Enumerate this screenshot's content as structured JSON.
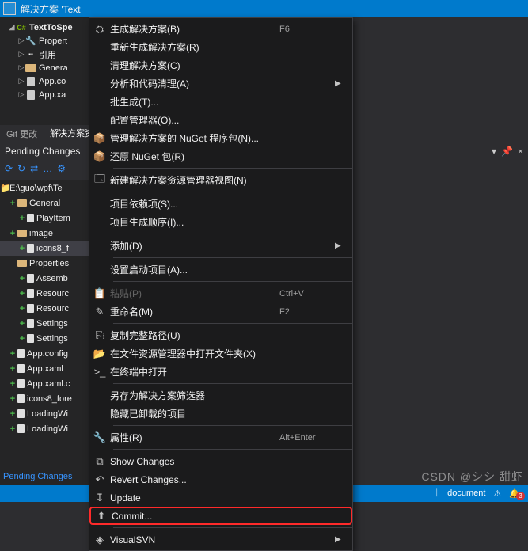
{
  "title_bar_text": "解决方案 'Text",
  "solution_tree": [
    {
      "indent": 10,
      "tri": "◢",
      "icon": "csproj",
      "label": "TextToSpe",
      "bold": true
    },
    {
      "indent": 22,
      "tri": "▷",
      "icon": "wrench",
      "label": "Propert"
    },
    {
      "indent": 22,
      "tri": "▷",
      "icon": "quote",
      "label": "引用"
    },
    {
      "indent": 22,
      "tri": "▷",
      "icon": "folder",
      "label": "Genera"
    },
    {
      "indent": 22,
      "tri": "▷",
      "icon": "file",
      "label": "App.co"
    },
    {
      "indent": 22,
      "tri": "▷",
      "icon": "file",
      "label": "App.xa"
    }
  ],
  "tabs": [
    {
      "label": "Git 更改",
      "active": false
    },
    {
      "label": "解决方案资",
      "active": true
    }
  ],
  "pending_header": "Pending Changes",
  "pin_icon": "📌",
  "close_icon": "×",
  "toolbar": [
    "⟳",
    "↻",
    "⇄",
    "…",
    "⚙"
  ],
  "pending_root": "E:\\guo\\wpf\\Te",
  "pending_items": [
    {
      "plus": true,
      "type": "folder",
      "label": "General",
      "indent": 10
    },
    {
      "plus": true,
      "type": "file",
      "label": "PlayItem",
      "indent": 22
    },
    {
      "plus": true,
      "type": "folder",
      "label": "image",
      "indent": 10
    },
    {
      "plus": true,
      "type": "file",
      "label": "icons8_f",
      "indent": 22,
      "hl": true
    },
    {
      "plus": false,
      "type": "folder",
      "label": "Properties",
      "indent": 10
    },
    {
      "plus": true,
      "type": "file",
      "label": "Assemb",
      "indent": 22
    },
    {
      "plus": true,
      "type": "file",
      "label": "Resourc",
      "indent": 22
    },
    {
      "plus": true,
      "type": "file",
      "label": "Resourc",
      "indent": 22
    },
    {
      "plus": true,
      "type": "file",
      "label": "Settings",
      "indent": 22
    },
    {
      "plus": true,
      "type": "file",
      "label": "Settings",
      "indent": 22
    },
    {
      "plus": true,
      "type": "file",
      "label": "App.config",
      "indent": 10
    },
    {
      "plus": true,
      "type": "file",
      "label": "App.xaml",
      "indent": 10
    },
    {
      "plus": true,
      "type": "file",
      "label": "App.xaml.c",
      "indent": 10
    },
    {
      "plus": true,
      "type": "file",
      "label": "icons8_fore",
      "indent": 10
    },
    {
      "plus": true,
      "type": "file",
      "label": "LoadingWi",
      "indent": 10
    },
    {
      "plus": true,
      "type": "file",
      "label": "LoadingWi",
      "indent": 10
    }
  ],
  "pending_status": "Pending Changes",
  "menu": [
    {
      "icon": "⛭",
      "label": "生成解决方案(B)",
      "shortcut": "F6"
    },
    {
      "icon": "",
      "label": "重新生成解决方案(R)"
    },
    {
      "icon": "",
      "label": "清理解决方案(C)"
    },
    {
      "icon": "",
      "label": "分析和代码清理(A)",
      "arrow": true
    },
    {
      "icon": "",
      "label": "批生成(T)..."
    },
    {
      "icon": "",
      "label": "配置管理器(O)..."
    },
    {
      "icon": "📦",
      "label": "管理解决方案的 NuGet 程序包(N)..."
    },
    {
      "icon": "📦",
      "label": "还原 NuGet 包(R)"
    },
    {
      "sep": true
    },
    {
      "icon": "🗔",
      "label": "新建解决方案资源管理器视图(N)"
    },
    {
      "sep": true
    },
    {
      "icon": "",
      "label": "项目依赖项(S)..."
    },
    {
      "icon": "",
      "label": "项目生成顺序(I)..."
    },
    {
      "sep": true
    },
    {
      "icon": "",
      "label": "添加(D)",
      "arrow": true
    },
    {
      "sep": true
    },
    {
      "icon": "",
      "label": "设置启动项目(A)..."
    },
    {
      "sep": true
    },
    {
      "icon": "📋",
      "label": "粘贴(P)",
      "shortcut": "Ctrl+V",
      "disabled": true
    },
    {
      "icon": "✎",
      "label": "重命名(M)",
      "shortcut": "F2"
    },
    {
      "sep": true
    },
    {
      "icon": "⎘",
      "label": "复制完整路径(U)"
    },
    {
      "icon": "📂",
      "label": "在文件资源管理器中打开文件夹(X)"
    },
    {
      "icon": ">_",
      "label": "在终端中打开"
    },
    {
      "sep": true
    },
    {
      "icon": "",
      "label": "另存为解决方案筛选器"
    },
    {
      "icon": "",
      "label": "隐藏已卸载的项目"
    },
    {
      "sep": true
    },
    {
      "icon": "🔧",
      "label": "属性(R)",
      "shortcut": "Alt+Enter"
    },
    {
      "sep": true
    },
    {
      "icon": "⧉",
      "label": "Show Changes"
    },
    {
      "icon": "↶",
      "label": "Revert Changes..."
    },
    {
      "icon": "↧",
      "label": "Update"
    },
    {
      "icon": "⬆",
      "label": "Commit...",
      "highlight": true
    },
    {
      "sep": true
    },
    {
      "icon": "◈",
      "label": "VisualSVN",
      "arrow": true
    }
  ],
  "watermark": "CSDN @シシ 甜虾",
  "status": {
    "branch_icon": "ᛁ",
    "doc_label": "document",
    "warn_icon": "⚠",
    "bell_icon": "🔔",
    "bell_count": "3"
  }
}
